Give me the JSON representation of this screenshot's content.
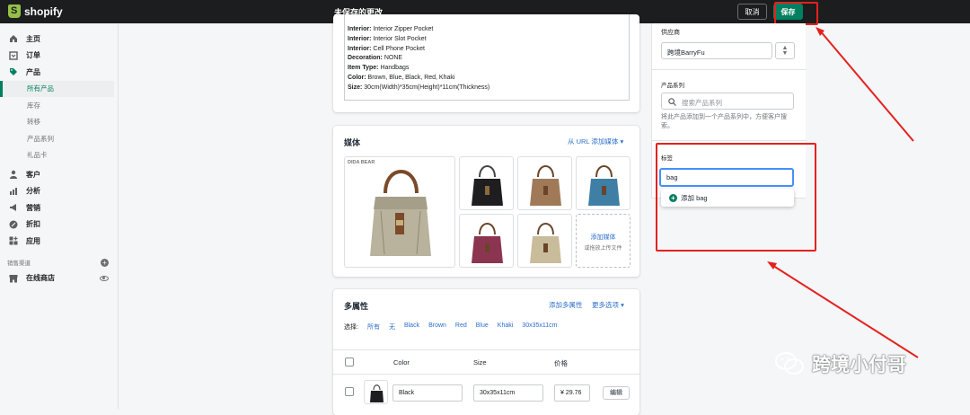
{
  "topbar": {
    "logo_text": "shopify",
    "unsaved_title": "未保存的更改",
    "cancel_label": "取消",
    "save_label": "保存"
  },
  "sidebar": {
    "items": [
      {
        "label": "主页",
        "icon": "home-icon"
      },
      {
        "label": "订单",
        "icon": "orders-icon"
      },
      {
        "label": "产品",
        "icon": "tag-icon"
      }
    ],
    "product_subitems": [
      "所有产品",
      "库存",
      "转移",
      "产品系列",
      "礼品卡"
    ],
    "items2": [
      {
        "label": "客户",
        "icon": "customer-icon"
      },
      {
        "label": "分析",
        "icon": "analytics-icon"
      },
      {
        "label": "营销",
        "icon": "megaphone-icon"
      },
      {
        "label": "折扣",
        "icon": "discount-icon"
      },
      {
        "label": "应用",
        "icon": "apps-icon"
      }
    ],
    "channels_label": "销售渠道",
    "online_store": "在线商店"
  },
  "description": {
    "lines": [
      {
        "k": "Interior:",
        "v": " Interior Zipper Pocket"
      },
      {
        "k": "Interior:",
        "v": " Interior Slot Pocket"
      },
      {
        "k": "Interior:",
        "v": " Cell Phone Pocket"
      },
      {
        "k": "Decoration:",
        "v": " NONE"
      },
      {
        "k": "Item Type:",
        "v": " Handbags"
      },
      {
        "k": "Color:",
        "v": " Brown, Blue, Black, Red, Khaki"
      },
      {
        "k": "Size:",
        "v": " 30cm(Width)*35cm(Height)*11cm(Thickness)"
      }
    ]
  },
  "media": {
    "title": "媒体",
    "url_link": "从 URL 添加媒体 ▾",
    "brand_watermark": "DIDA BEAR",
    "add_media": "添加媒体",
    "drop_hint": "或拖放上传文件",
    "bag_colors": [
      "#1e1e20",
      "#a07a58",
      "#3f7ea5",
      "#8c3550",
      "#c9bc9b"
    ]
  },
  "variants": {
    "title": "多属性",
    "add_variant": "添加多属性",
    "more_options": "更多选项 ▾",
    "select_label": "选择:",
    "filters": [
      "所有",
      "无",
      "Black",
      "Brown",
      "Red",
      "Blue",
      "Khaki",
      "30x35x11cm"
    ],
    "col_color": "Color",
    "col_size": "Size",
    "col_price": "价格",
    "row1": {
      "color": "Black",
      "size": "30x35x11cm",
      "price": "¥  29.76",
      "edit": "编辑"
    }
  },
  "right": {
    "vendor_label": "供应商",
    "vendor_value": "跨境BarryFu",
    "collection_label": "产品系列",
    "collection_placeholder": "搜索产品系列",
    "collection_help": "将此产品添加到一个产品系列中，方便客户搜索。",
    "tags_label": "标签",
    "tag_value": "bag",
    "tag_suggestion": "添加 bag"
  },
  "watermark": "跨境小付哥",
  "colors": {
    "accent": "#008060",
    "annotation": "#e5211e",
    "link": "#2c6ecb"
  }
}
